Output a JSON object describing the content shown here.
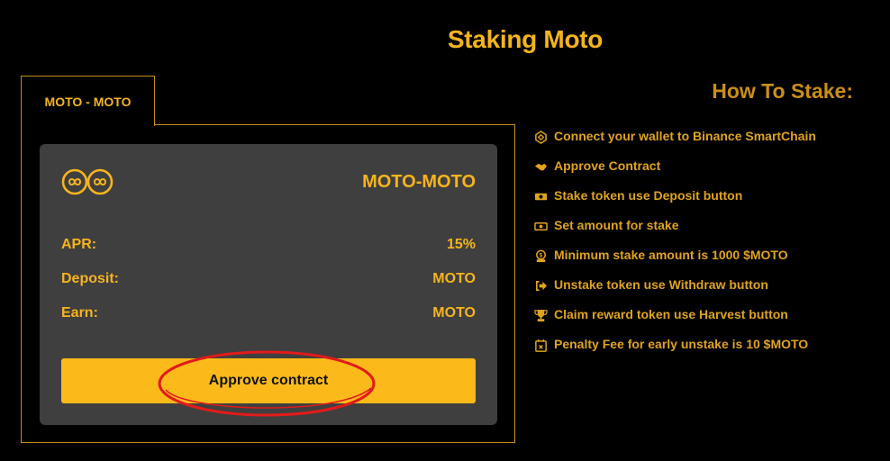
{
  "page": {
    "title": "Staking Moto"
  },
  "pool": {
    "tab_label": "MOTO - MOTO",
    "card": {
      "name": "MOTO-MOTO",
      "logo_icon": "infinity-coin-icon",
      "stats": [
        {
          "label": "APR:",
          "value": "15%"
        },
        {
          "label": "Deposit:",
          "value": "MOTO"
        },
        {
          "label": "Earn:",
          "value": "MOTO"
        }
      ],
      "approve_label": "Approve contract"
    }
  },
  "how_to": {
    "title": "How To Stake:",
    "steps": [
      {
        "icon": "binance-icon",
        "text": "Connect your wallet to Binance SmartChain"
      },
      {
        "icon": "handshake-icon",
        "text": "Approve Contract"
      },
      {
        "icon": "money-bill-icon",
        "text": "Stake token use Deposit button"
      },
      {
        "icon": "money-bill-outline-icon",
        "text": "Set amount for stake"
      },
      {
        "icon": "coin-stack-icon",
        "text": "Minimum stake amount is 1000 $MOTO"
      },
      {
        "icon": "sign-out-icon",
        "text": "Unstake token use Withdraw button"
      },
      {
        "icon": "trophy-icon",
        "text": "Claim reward token use Harvest button"
      },
      {
        "icon": "calendar-x-icon",
        "text": "Penalty Fee for early unstake is 10 $MOTO"
      }
    ]
  },
  "colors": {
    "accent": "#f6b41c",
    "button": "#fcba1a",
    "card_bg": "#3f3f3f",
    "border": "#c68d14",
    "annotation": "#e21b1b"
  }
}
